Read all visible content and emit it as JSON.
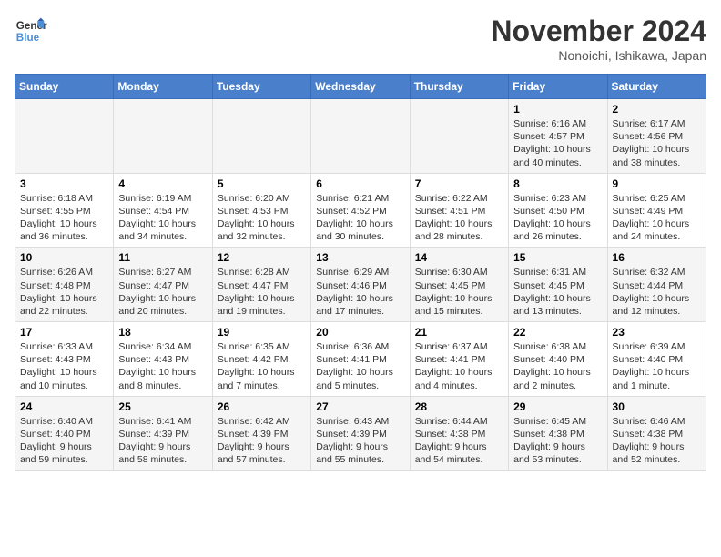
{
  "logo": {
    "line1": "General",
    "line2": "Blue"
  },
  "title": "November 2024",
  "location": "Nonoichi, Ishikawa, Japan",
  "days_of_week": [
    "Sunday",
    "Monday",
    "Tuesday",
    "Wednesday",
    "Thursday",
    "Friday",
    "Saturday"
  ],
  "weeks": [
    [
      {
        "day": "",
        "info": ""
      },
      {
        "day": "",
        "info": ""
      },
      {
        "day": "",
        "info": ""
      },
      {
        "day": "",
        "info": ""
      },
      {
        "day": "",
        "info": ""
      },
      {
        "day": "1",
        "info": "Sunrise: 6:16 AM\nSunset: 4:57 PM\nDaylight: 10 hours and 40 minutes."
      },
      {
        "day": "2",
        "info": "Sunrise: 6:17 AM\nSunset: 4:56 PM\nDaylight: 10 hours and 38 minutes."
      }
    ],
    [
      {
        "day": "3",
        "info": "Sunrise: 6:18 AM\nSunset: 4:55 PM\nDaylight: 10 hours and 36 minutes."
      },
      {
        "day": "4",
        "info": "Sunrise: 6:19 AM\nSunset: 4:54 PM\nDaylight: 10 hours and 34 minutes."
      },
      {
        "day": "5",
        "info": "Sunrise: 6:20 AM\nSunset: 4:53 PM\nDaylight: 10 hours and 32 minutes."
      },
      {
        "day": "6",
        "info": "Sunrise: 6:21 AM\nSunset: 4:52 PM\nDaylight: 10 hours and 30 minutes."
      },
      {
        "day": "7",
        "info": "Sunrise: 6:22 AM\nSunset: 4:51 PM\nDaylight: 10 hours and 28 minutes."
      },
      {
        "day": "8",
        "info": "Sunrise: 6:23 AM\nSunset: 4:50 PM\nDaylight: 10 hours and 26 minutes."
      },
      {
        "day": "9",
        "info": "Sunrise: 6:25 AM\nSunset: 4:49 PM\nDaylight: 10 hours and 24 minutes."
      }
    ],
    [
      {
        "day": "10",
        "info": "Sunrise: 6:26 AM\nSunset: 4:48 PM\nDaylight: 10 hours and 22 minutes."
      },
      {
        "day": "11",
        "info": "Sunrise: 6:27 AM\nSunset: 4:47 PM\nDaylight: 10 hours and 20 minutes."
      },
      {
        "day": "12",
        "info": "Sunrise: 6:28 AM\nSunset: 4:47 PM\nDaylight: 10 hours and 19 minutes."
      },
      {
        "day": "13",
        "info": "Sunrise: 6:29 AM\nSunset: 4:46 PM\nDaylight: 10 hours and 17 minutes."
      },
      {
        "day": "14",
        "info": "Sunrise: 6:30 AM\nSunset: 4:45 PM\nDaylight: 10 hours and 15 minutes."
      },
      {
        "day": "15",
        "info": "Sunrise: 6:31 AM\nSunset: 4:45 PM\nDaylight: 10 hours and 13 minutes."
      },
      {
        "day": "16",
        "info": "Sunrise: 6:32 AM\nSunset: 4:44 PM\nDaylight: 10 hours and 12 minutes."
      }
    ],
    [
      {
        "day": "17",
        "info": "Sunrise: 6:33 AM\nSunset: 4:43 PM\nDaylight: 10 hours and 10 minutes."
      },
      {
        "day": "18",
        "info": "Sunrise: 6:34 AM\nSunset: 4:43 PM\nDaylight: 10 hours and 8 minutes."
      },
      {
        "day": "19",
        "info": "Sunrise: 6:35 AM\nSunset: 4:42 PM\nDaylight: 10 hours and 7 minutes."
      },
      {
        "day": "20",
        "info": "Sunrise: 6:36 AM\nSunset: 4:41 PM\nDaylight: 10 hours and 5 minutes."
      },
      {
        "day": "21",
        "info": "Sunrise: 6:37 AM\nSunset: 4:41 PM\nDaylight: 10 hours and 4 minutes."
      },
      {
        "day": "22",
        "info": "Sunrise: 6:38 AM\nSunset: 4:40 PM\nDaylight: 10 hours and 2 minutes."
      },
      {
        "day": "23",
        "info": "Sunrise: 6:39 AM\nSunset: 4:40 PM\nDaylight: 10 hours and 1 minute."
      }
    ],
    [
      {
        "day": "24",
        "info": "Sunrise: 6:40 AM\nSunset: 4:40 PM\nDaylight: 9 hours and 59 minutes."
      },
      {
        "day": "25",
        "info": "Sunrise: 6:41 AM\nSunset: 4:39 PM\nDaylight: 9 hours and 58 minutes."
      },
      {
        "day": "26",
        "info": "Sunrise: 6:42 AM\nSunset: 4:39 PM\nDaylight: 9 hours and 57 minutes."
      },
      {
        "day": "27",
        "info": "Sunrise: 6:43 AM\nSunset: 4:39 PM\nDaylight: 9 hours and 55 minutes."
      },
      {
        "day": "28",
        "info": "Sunrise: 6:44 AM\nSunset: 4:38 PM\nDaylight: 9 hours and 54 minutes."
      },
      {
        "day": "29",
        "info": "Sunrise: 6:45 AM\nSunset: 4:38 PM\nDaylight: 9 hours and 53 minutes."
      },
      {
        "day": "30",
        "info": "Sunrise: 6:46 AM\nSunset: 4:38 PM\nDaylight: 9 hours and 52 minutes."
      }
    ]
  ]
}
